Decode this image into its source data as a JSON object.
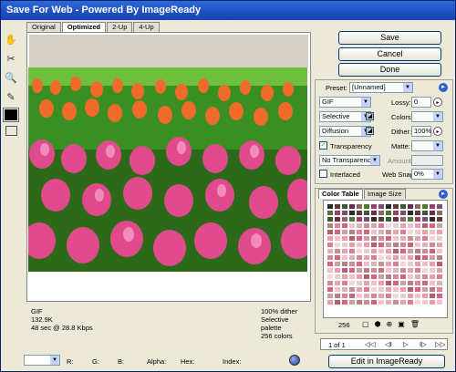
{
  "window": {
    "title": "Save For Web - Powered By ImageReady"
  },
  "tabs": [
    "Original",
    "Optimized",
    "2-Up",
    "4-Up"
  ],
  "info": {
    "left": [
      "GIF",
      "132.9K",
      "48 sec @ 28.8 Kbps"
    ],
    "right": [
      "100% dither",
      "Selective palette",
      "256 colors"
    ]
  },
  "buttons": {
    "save": "Save",
    "cancel": "Cancel",
    "done": "Done"
  },
  "settings": {
    "preset_label": "Preset:",
    "preset_value": "[Unnamed]",
    "format": "GIF",
    "lossy_label": "Lossy:",
    "lossy_value": "0",
    "palette": "Selective",
    "colors_label": "Colors:",
    "dither_algo": "Diffusion",
    "dither_label": "Dither:",
    "dither_value": "100%",
    "transparency_label": "Transparency",
    "matte_label": "Matte:",
    "transp_dither": "No Transparency ...",
    "amount_label": "Amount:",
    "interlaced_label": "Interlaced",
    "websnap_label": "Web Snap:",
    "websnap_value": "0%"
  },
  "panel_tabs": {
    "color_table": "Color Table",
    "image_size": "Image Size"
  },
  "color_table": {
    "count": "256"
  },
  "nav": {
    "page": "1 of 1"
  },
  "statusbar": {
    "r": "R:",
    "g": "G:",
    "b": "B:",
    "alpha": "Alpha:",
    "hex": "Hex:",
    "index": "Index:"
  },
  "edit_button": "Edit in ImageReady",
  "colors": {
    "palette": [
      "#e6cfc6",
      "#d7b6b5",
      "#c8a1a3",
      "#e7a0a7",
      "#cf8c90",
      "#b97f80",
      "#f2c0cc",
      "#e1a3b1",
      "#d68a98",
      "#f199b1",
      "#e07b94",
      "#cc6a7d",
      "#b15f6f",
      "#f5d6de",
      "#f7bfd0",
      "#dc5f86"
    ]
  }
}
